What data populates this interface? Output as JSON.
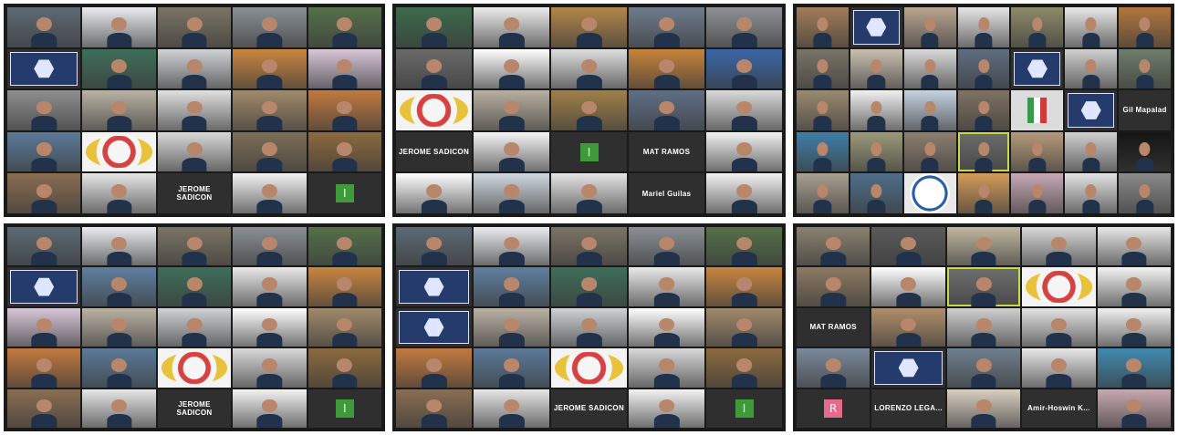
{
  "panels": [
    {
      "id": "top-left",
      "cols": 5,
      "rows": 5,
      "tiles": [
        {
          "kind": "photo",
          "caption": "",
          "bg": "#5d6a75"
        },
        {
          "kind": "photo",
          "caption": "",
          "bg": "#e9ebee"
        },
        {
          "kind": "photo",
          "caption": "",
          "bg": "#7c7464"
        },
        {
          "kind": "photo",
          "caption": "",
          "bg": "#8a9096"
        },
        {
          "kind": "photo",
          "caption": "",
          "bg": "#55704a"
        },
        {
          "kind": "poster",
          "caption": ""
        },
        {
          "kind": "photo",
          "caption": "",
          "bg": "#3f6e5a"
        },
        {
          "kind": "photo",
          "caption": "",
          "bg": "#cfd2d5"
        },
        {
          "kind": "photo",
          "caption": "",
          "bg": "#c9863f"
        },
        {
          "kind": "photo",
          "caption": "",
          "bg": "#d7c6d8"
        },
        {
          "kind": "photo",
          "caption": "",
          "bg": "#8f8f8f"
        },
        {
          "kind": "photo",
          "caption": "",
          "bg": "#b9b2a4"
        },
        {
          "kind": "photo",
          "caption": "",
          "bg": "#e0e0e0"
        },
        {
          "kind": "photo",
          "caption": "",
          "bg": "#a08a6a"
        },
        {
          "kind": "photo",
          "caption": "",
          "bg": "#c27a3e"
        },
        {
          "kind": "photo",
          "caption": "",
          "bg": "#5c7a9a"
        },
        {
          "kind": "logo",
          "caption": ""
        },
        {
          "kind": "photo",
          "caption": "",
          "bg": "#d8d8d8"
        },
        {
          "kind": "photo",
          "caption": "",
          "bg": "#7d6f55"
        },
        {
          "kind": "photo",
          "caption": "",
          "bg": "#8c6a3e"
        },
        {
          "kind": "photo",
          "caption": "",
          "bg": "#8a6e52"
        },
        {
          "kind": "photo",
          "caption": "",
          "bg": "#e6e6e6"
        },
        {
          "kind": "name",
          "caption": "JEROME SADICON"
        },
        {
          "kind": "photo",
          "caption": "",
          "bg": "#f2f2f2"
        },
        {
          "kind": "avatar",
          "caption": "",
          "letter": "I",
          "color": "#3f9a3a"
        }
      ]
    },
    {
      "id": "top-center",
      "cols": 5,
      "rows": 5,
      "tiles": [
        {
          "kind": "photo",
          "caption": "",
          "bg": "#3d6a4c"
        },
        {
          "kind": "photo",
          "caption": "",
          "bg": "#ececec"
        },
        {
          "kind": "photo",
          "caption": "",
          "bg": "#b2874a"
        },
        {
          "kind": "photo",
          "caption": "",
          "bg": "#6f7c8c"
        },
        {
          "kind": "photo",
          "caption": "",
          "bg": "#8e9296"
        },
        {
          "kind": "photo",
          "caption": "",
          "bg": "#6a6a6a"
        },
        {
          "kind": "photo",
          "caption": "",
          "bg": "#ffffff"
        },
        {
          "kind": "photo",
          "caption": "",
          "bg": "#dedede"
        },
        {
          "kind": "photo",
          "caption": "",
          "bg": "#c7833a"
        },
        {
          "kind": "photo",
          "caption": "",
          "bg": "#3a66a6"
        },
        {
          "kind": "logo",
          "caption": ""
        },
        {
          "kind": "photo",
          "caption": "",
          "bg": "#b8b0a0"
        },
        {
          "kind": "photo",
          "caption": "",
          "bg": "#a08049"
        },
        {
          "kind": "photo",
          "caption": "",
          "bg": "#5f6f86"
        },
        {
          "kind": "photo",
          "caption": "",
          "bg": "#d9d9d9"
        },
        {
          "kind": "name",
          "caption": "JEROME SADICON"
        },
        {
          "kind": "photo",
          "caption": "",
          "bg": "#f4f4f4"
        },
        {
          "kind": "avatar",
          "caption": "",
          "letter": "I",
          "color": "#3f9a3a"
        },
        {
          "kind": "name",
          "caption": "MAT RAMOS"
        },
        {
          "kind": "photo",
          "caption": "",
          "bg": "#f0f0f0"
        },
        {
          "kind": "photo",
          "caption": "",
          "bg": "#ffffff"
        },
        {
          "kind": "photo",
          "caption": "",
          "bg": "#cfd8e0"
        },
        {
          "kind": "photo",
          "caption": "",
          "bg": "#e4e4e4"
        },
        {
          "kind": "name",
          "caption": "Mariel Guilas"
        },
        {
          "kind": "photo",
          "caption": "",
          "bg": "#f2f2f2"
        }
      ]
    },
    {
      "id": "top-right",
      "cols": 7,
      "rows": 7,
      "tiles": [
        {
          "kind": "photo",
          "caption": "",
          "bg": "#a37d58"
        },
        {
          "kind": "poster",
          "caption": ""
        },
        {
          "kind": "photo",
          "caption": "",
          "bg": "#b9a690"
        },
        {
          "kind": "photo",
          "caption": "",
          "bg": "#e6e6e6"
        },
        {
          "kind": "photo",
          "caption": "",
          "bg": "#8d8a6a"
        },
        {
          "kind": "photo",
          "caption": "",
          "bg": "#e8e8e8"
        },
        {
          "kind": "photo",
          "caption": "",
          "bg": "#b3773d"
        },
        {
          "kind": "photo",
          "caption": "",
          "bg": "#7a7468"
        },
        {
          "kind": "photo",
          "caption": "",
          "bg": "#c8c0b0"
        },
        {
          "kind": "photo",
          "caption": "",
          "bg": "#d9d9d9"
        },
        {
          "kind": "photo",
          "caption": "",
          "bg": "#5e6e80"
        },
        {
          "kind": "poster",
          "caption": ""
        },
        {
          "kind": "photo",
          "caption": "",
          "bg": "#cfcfcf"
        },
        {
          "kind": "photo",
          "caption": "",
          "bg": "#6e7d6a"
        },
        {
          "kind": "photo",
          "caption": "",
          "bg": "#9a8a70"
        },
        {
          "kind": "photo",
          "caption": "",
          "bg": "#f0f0f0"
        },
        {
          "kind": "photo",
          "caption": "",
          "bg": "#c4d2e0"
        },
        {
          "kind": "photo",
          "caption": "",
          "bg": "#7f7262"
        },
        {
          "kind": "flag",
          "caption": ""
        },
        {
          "kind": "poster",
          "caption": ""
        },
        {
          "kind": "name",
          "caption": "Gil Mapalad"
        },
        {
          "kind": "photo",
          "caption": "",
          "bg": "#3f7ea8"
        },
        {
          "kind": "photo",
          "caption": "",
          "bg": "#9c9a7a"
        },
        {
          "kind": "photo",
          "caption": "",
          "bg": "#8d7f70"
        },
        {
          "kind": "photo",
          "caption": "",
          "bg": "#6c6c6c",
          "active": true
        },
        {
          "kind": "photo",
          "caption": "",
          "bg": "#b59a7a"
        },
        {
          "kind": "photo",
          "caption": "",
          "bg": "#d0d0d0"
        },
        {
          "kind": "photo",
          "caption": "",
          "bg": "#151515"
        },
        {
          "kind": "photo",
          "caption": "",
          "bg": "#a8a090"
        },
        {
          "kind": "photo",
          "caption": "",
          "bg": "#4f6f8a"
        },
        {
          "kind": "seal",
          "caption": ""
        },
        {
          "kind": "photo",
          "caption": "",
          "bg": "#d49a5a"
        },
        {
          "kind": "photo",
          "caption": "",
          "bg": "#c7a9b5"
        },
        {
          "kind": "photo",
          "caption": "",
          "bg": "#e3e3e3"
        },
        {
          "kind": "photo",
          "caption": "",
          "bg": "#8a8a8a"
        }
      ]
    },
    {
      "id": "bottom-left",
      "cols": 5,
      "rows": 6,
      "tiles": [
        {
          "kind": "photo",
          "caption": "",
          "bg": "#5d6a75"
        },
        {
          "kind": "photo",
          "caption": "",
          "bg": "#e9ebee"
        },
        {
          "kind": "photo",
          "caption": "",
          "bg": "#7c7464"
        },
        {
          "kind": "photo",
          "caption": "",
          "bg": "#8a9096"
        },
        {
          "kind": "photo",
          "caption": "",
          "bg": "#55704a"
        },
        {
          "kind": "poster",
          "caption": ""
        },
        {
          "kind": "photo",
          "caption": "",
          "bg": "#5f7fa0"
        },
        {
          "kind": "photo",
          "caption": "",
          "bg": "#3f6e5a"
        },
        {
          "kind": "photo",
          "caption": "",
          "bg": "#e9e9e9"
        },
        {
          "kind": "photo",
          "caption": "",
          "bg": "#c9863f"
        },
        {
          "kind": "photo",
          "caption": "",
          "bg": "#d7c6d8"
        },
        {
          "kind": "photo",
          "caption": "",
          "bg": "#b9b2a4"
        },
        {
          "kind": "photo",
          "caption": "",
          "bg": "#cfd2d5"
        },
        {
          "kind": "photo",
          "caption": "",
          "bg": "#ffffff"
        },
        {
          "kind": "photo",
          "caption": "",
          "bg": "#a08a6a"
        },
        {
          "kind": "photo",
          "caption": "",
          "bg": "#c27a3e"
        },
        {
          "kind": "photo",
          "caption": "",
          "bg": "#5c7a9a"
        },
        {
          "kind": "logo",
          "caption": ""
        },
        {
          "kind": "photo",
          "caption": "",
          "bg": "#d8d8d8"
        },
        {
          "kind": "photo",
          "caption": "",
          "bg": "#8c6a3e"
        },
        {
          "kind": "photo",
          "caption": "",
          "bg": "#8a6e52"
        },
        {
          "kind": "photo",
          "caption": "",
          "bg": "#e6e6e6"
        },
        {
          "kind": "name",
          "caption": "JEROME SADICON"
        },
        {
          "kind": "photo",
          "caption": "",
          "bg": "#f2f2f2"
        },
        {
          "kind": "avatar",
          "caption": "",
          "letter": "I",
          "color": "#3f9a3a"
        }
      ]
    },
    {
      "id": "bottom-center",
      "cols": 5,
      "rows": 6,
      "tiles": [
        {
          "kind": "photo",
          "caption": "",
          "bg": "#5d6a75"
        },
        {
          "kind": "photo",
          "caption": "",
          "bg": "#e9ebee"
        },
        {
          "kind": "photo",
          "caption": "",
          "bg": "#7c7464"
        },
        {
          "kind": "photo",
          "caption": "",
          "bg": "#8a9096"
        },
        {
          "kind": "photo",
          "caption": "",
          "bg": "#55704a"
        },
        {
          "kind": "poster",
          "caption": ""
        },
        {
          "kind": "photo",
          "caption": "",
          "bg": "#5f7fa0"
        },
        {
          "kind": "photo",
          "caption": "",
          "bg": "#3f6e5a"
        },
        {
          "kind": "photo",
          "caption": "",
          "bg": "#e9e9e9"
        },
        {
          "kind": "photo",
          "caption": "",
          "bg": "#c9863f"
        },
        {
          "kind": "poster",
          "caption": ""
        },
        {
          "kind": "photo",
          "caption": "",
          "bg": "#b9b2a4"
        },
        {
          "kind": "photo",
          "caption": "",
          "bg": "#cfd2d5"
        },
        {
          "kind": "photo",
          "caption": "",
          "bg": "#ffffff"
        },
        {
          "kind": "photo",
          "caption": "",
          "bg": "#a08a6a"
        },
        {
          "kind": "photo",
          "caption": "",
          "bg": "#c27a3e"
        },
        {
          "kind": "photo",
          "caption": "",
          "bg": "#5c7a9a"
        },
        {
          "kind": "logo",
          "caption": ""
        },
        {
          "kind": "photo",
          "caption": "",
          "bg": "#d8d8d8"
        },
        {
          "kind": "photo",
          "caption": "",
          "bg": "#8c6a3e"
        },
        {
          "kind": "photo",
          "caption": "",
          "bg": "#8a6e52"
        },
        {
          "kind": "photo",
          "caption": "",
          "bg": "#e6e6e6"
        },
        {
          "kind": "name",
          "caption": "JEROME SADICON"
        },
        {
          "kind": "photo",
          "caption": "",
          "bg": "#f2f2f2"
        },
        {
          "kind": "avatar",
          "caption": "",
          "letter": "I",
          "color": "#3f9a3a"
        }
      ]
    },
    {
      "id": "bottom-right",
      "cols": 5,
      "rows": 5,
      "tiles": [
        {
          "kind": "photo",
          "caption": "",
          "bg": "#8a8270"
        },
        {
          "kind": "photo",
          "caption": "",
          "bg": "#5a5a5a"
        },
        {
          "kind": "photo",
          "caption": "",
          "bg": "#c0b8a0"
        },
        {
          "kind": "photo",
          "caption": "",
          "bg": "#d9d9d9"
        },
        {
          "kind": "photo",
          "caption": "",
          "bg": "#e7e7e7"
        },
        {
          "kind": "photo",
          "caption": "",
          "bg": "#8c7a62"
        },
        {
          "kind": "photo",
          "caption": "",
          "bg": "#ffffff"
        },
        {
          "kind": "photo",
          "caption": "",
          "bg": "#6f6f6f",
          "active": true
        },
        {
          "kind": "logo",
          "caption": ""
        },
        {
          "kind": "photo",
          "caption": "",
          "bg": "#f3f3f3"
        },
        {
          "kind": "name",
          "caption": "MAT RAMOS"
        },
        {
          "kind": "photo",
          "caption": "",
          "bg": "#b08e6a"
        },
        {
          "kind": "photo",
          "caption": "",
          "bg": "#cfcfcf"
        },
        {
          "kind": "photo",
          "caption": "",
          "bg": "#e3e3e3"
        },
        {
          "kind": "photo",
          "caption": "",
          "bg": "#f1f1f1"
        },
        {
          "kind": "photo",
          "caption": "",
          "bg": "#7a8a9a"
        },
        {
          "kind": "poster",
          "caption": ""
        },
        {
          "kind": "photo",
          "caption": "",
          "bg": "#6f7f8f"
        },
        {
          "kind": "photo",
          "caption": "",
          "bg": "#e8e8e8"
        },
        {
          "kind": "photo",
          "caption": "",
          "bg": "#3f8ab0"
        },
        {
          "kind": "avatar",
          "caption": "",
          "letter": "R",
          "color": "#e66a8a"
        },
        {
          "kind": "name",
          "caption": "LORENZO LEGA..."
        },
        {
          "kind": "photo",
          "caption": "",
          "bg": "#d8cfc0"
        },
        {
          "kind": "name",
          "caption": "Amir-Hoswin K..."
        },
        {
          "kind": "photo",
          "caption": "",
          "bg": "#c8a8b0"
        }
      ]
    }
  ]
}
